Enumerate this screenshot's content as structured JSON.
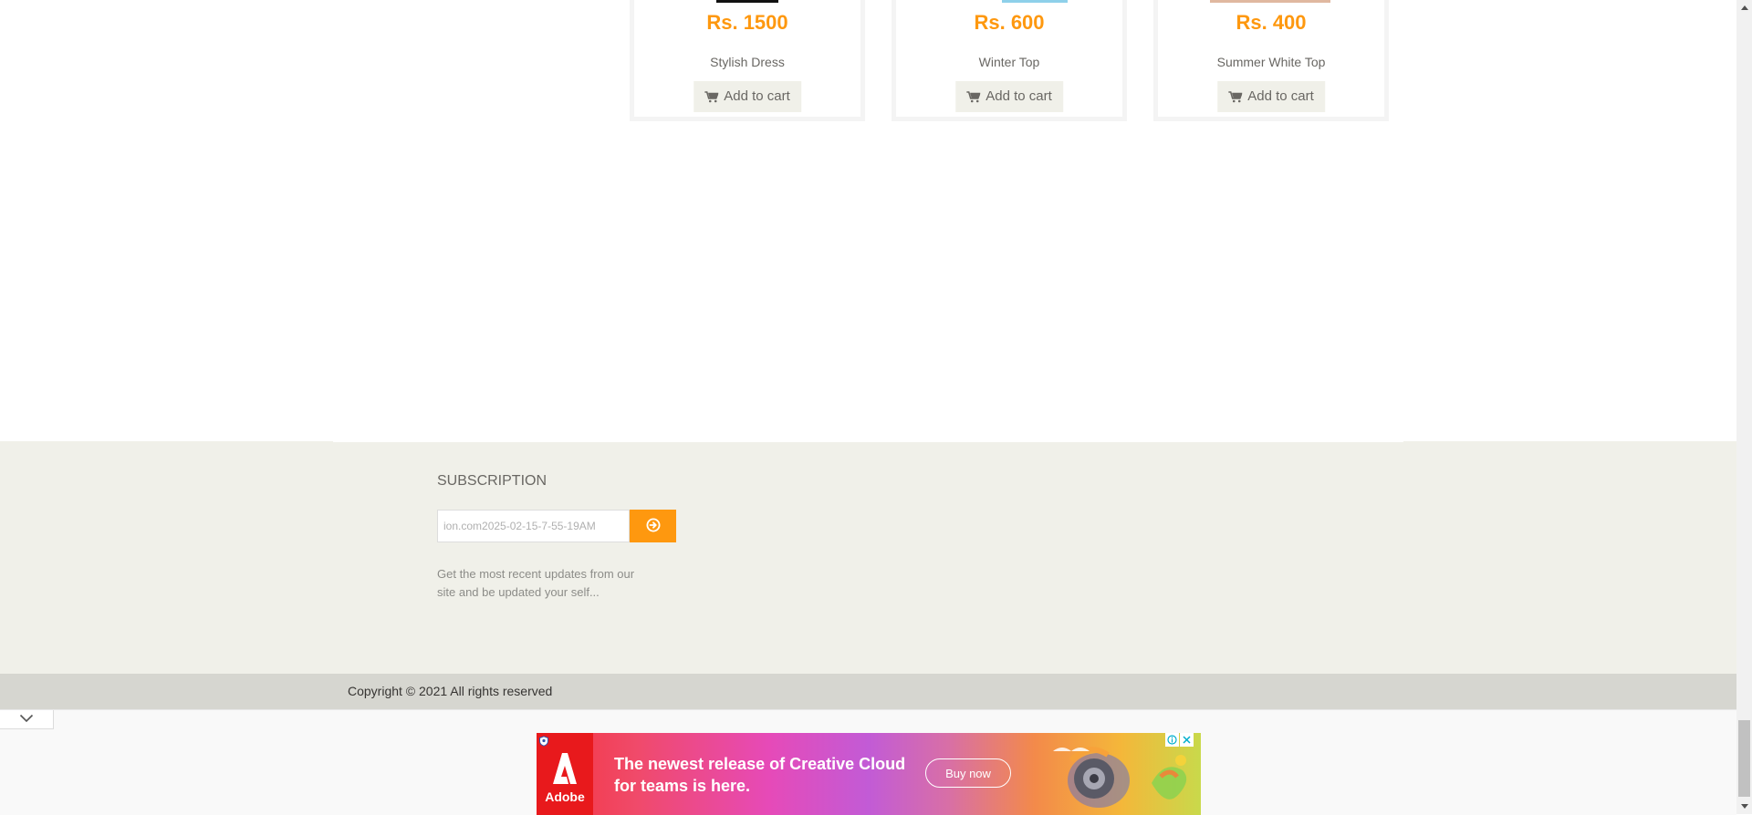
{
  "products": [
    {
      "price": "Rs. 1500",
      "name": "Stylish Dress",
      "button_label": "Add to cart"
    },
    {
      "price": "Rs. 600",
      "name": "Winter Top",
      "button_label": "Add to cart"
    },
    {
      "price": "Rs. 400",
      "name": "Summer White Top",
      "button_label": "Add to cart"
    }
  ],
  "subscription": {
    "title": "SUBSCRIPTION",
    "input_value": "ion.com2025-02-15-7-55-19AM",
    "description": "Get the most recent updates from our site and be updated your self..."
  },
  "footer": {
    "copyright": "Copyright © 2021 All rights reserved"
  },
  "ad": {
    "brand": "Adobe",
    "headline": "The newest release of Creative Cloud for teams is here.",
    "cta": "Buy now"
  },
  "icons": {
    "cart": "shopping-cart-icon",
    "subscribe": "arrow-circle-right-icon",
    "collapse": "chevron-down-icon",
    "ad_choices": "ad-choices-icon",
    "ad_close": "close-icon"
  },
  "colors": {
    "accent": "#fe980f",
    "footer_bg": "#f0f0e9",
    "footer_bottom_bg": "#d6d6d0"
  }
}
